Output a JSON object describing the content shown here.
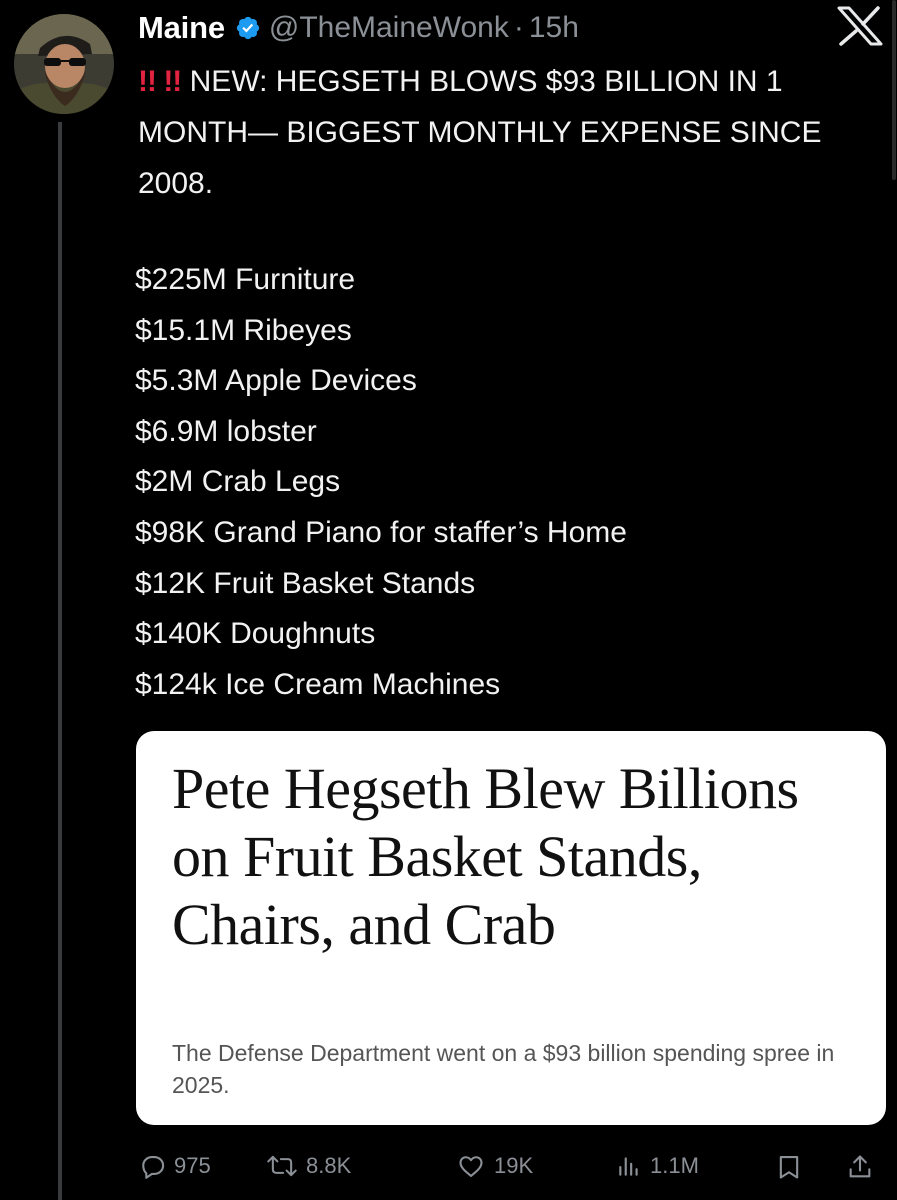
{
  "tweet": {
    "author_name": "Maine",
    "handle": "@TheMaineWonk",
    "separator": "·",
    "time": "15h",
    "alert_marks": "!! !!",
    "text": "NEW: HEGSETH BLOWS $93 BILLION IN 1 MONTH— BIGGEST MONTHLY EXPENSE SINCE 2008.",
    "items": [
      "$225M Furniture",
      "$15.1M Ribeyes",
      "$5.3M Apple Devices",
      "$6.9M lobster",
      "$2M Crab Legs",
      "$98K Grand Piano for staffer’s Home",
      "$12K Fruit Basket Stands",
      "$140K Doughnuts",
      "$124k Ice Cream Machines"
    ]
  },
  "card": {
    "headline": "Pete Hegseth Blew Billions on Fruit Basket Stands, Chairs, and Crab",
    "subtitle": "The Defense Department went on a $93 billion spending spree in 2025."
  },
  "actions": {
    "replies": "975",
    "reposts": "8.8K",
    "likes": "19K",
    "views": "1.1M"
  },
  "icons": {
    "verified": "verified-badge-icon",
    "logo": "x-logo-icon",
    "reply": "reply-icon",
    "repost": "repost-icon",
    "like": "heart-icon",
    "views": "views-icon",
    "bookmark": "bookmark-icon",
    "share": "share-icon"
  },
  "colors": {
    "background": "#000000",
    "text": "#e7e9ea",
    "secondary": "#8b9096",
    "verified": "#1d9bf0",
    "alert": "#e0233e",
    "card": "#ffffff"
  }
}
